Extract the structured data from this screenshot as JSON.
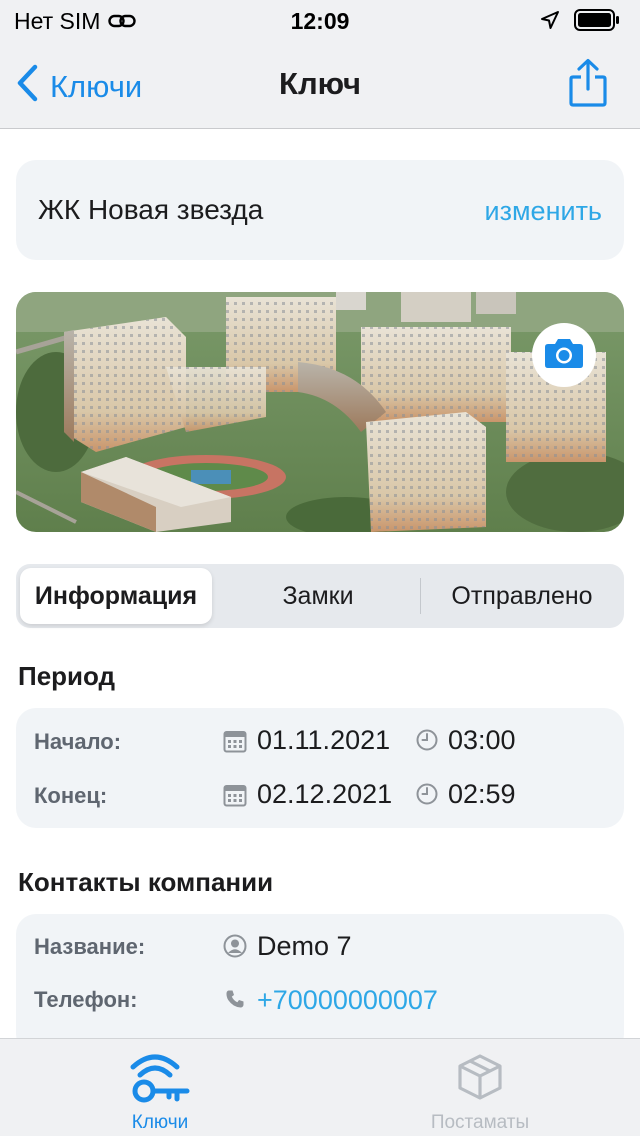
{
  "status_bar": {
    "carrier": "Нет SIM",
    "time": "12:09"
  },
  "nav": {
    "back_label": "Ключи",
    "title": "Ключ"
  },
  "complex": {
    "name": "ЖК Новая звезда",
    "change_label": "изменить"
  },
  "segments": [
    {
      "label": "Информация",
      "active": true
    },
    {
      "label": "Замки",
      "active": false
    },
    {
      "label": "Отправлено",
      "active": false
    }
  ],
  "period": {
    "title": "Период",
    "start_label": "Начало:",
    "start_date": "01.11.2021",
    "start_time": "03:00",
    "end_label": "Конец:",
    "end_date": "02.12.2021",
    "end_time": "02:59"
  },
  "contacts": {
    "title": "Контакты компании",
    "name_label": "Название:",
    "name_value": "Demo 7",
    "phone_label": "Телефон:",
    "phone_value": "+70000000007"
  },
  "tab_bar": {
    "items": [
      {
        "label": "Ключи",
        "icon": "wifi-key-icon",
        "active": true
      },
      {
        "label": "Постаматы",
        "icon": "box-icon",
        "active": false
      }
    ]
  },
  "colors": {
    "accent": "#1a8be8",
    "link": "#2ea7e6",
    "card_bg": "#f1f4f7",
    "bar_bg": "#f0f1f3",
    "label_gray": "#5f6670",
    "inactive_tab": "#b7bcc2"
  }
}
